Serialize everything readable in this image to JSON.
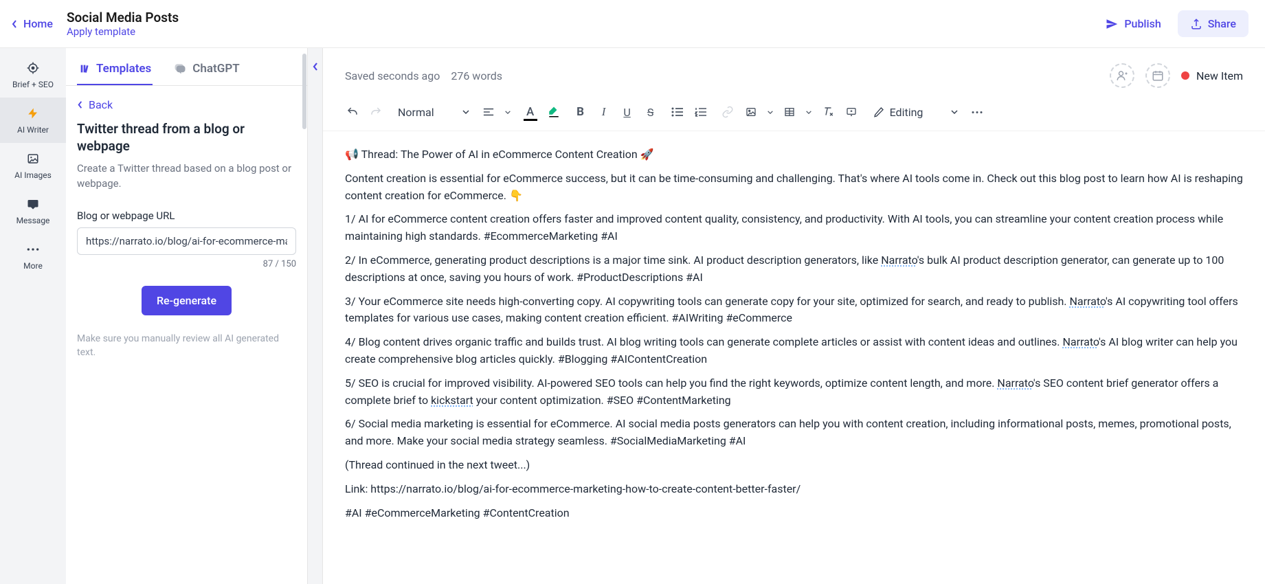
{
  "header": {
    "home": "Home",
    "title": "Social Media Posts",
    "apply_template": "Apply template",
    "publish": "Publish",
    "share": "Share"
  },
  "nav": {
    "brief_seo": "Brief + SEO",
    "ai_writer": "AI Writer",
    "ai_images": "AI Images",
    "message": "Message",
    "more": "More"
  },
  "panel": {
    "tab_templates": "Templates",
    "tab_chatgpt": "ChatGPT",
    "back": "Back",
    "template_title": "Twitter thread from a blog or webpage",
    "template_desc": "Create a Twitter thread based on a blog post or webpage.",
    "url_label": "Blog or webpage URL",
    "url_value": "https://narrato.io/blog/ai-for-ecommerce-ma",
    "char_count": "87 / 150",
    "regenerate": "Re-generate",
    "disclaimer": "Make sure you manually review all AI generated text."
  },
  "editor": {
    "saved": "Saved seconds ago",
    "word_count": "276 words",
    "status": "New Item",
    "style": "Normal",
    "mode": "Editing",
    "paragraphs": [
      "📢 Thread: The Power of AI in eCommerce Content Creation 🚀",
      "Content creation is essential for eCommerce success, but it can be time-consuming and challenging. That's where AI tools come in. Check out this blog post to learn how AI is reshaping content creation for eCommerce. 👇",
      "1/ AI for eCommerce content creation offers faster and improved content quality, consistency, and productivity. With AI tools, you can streamline your content creation process while maintaining high standards. #EcommerceMarketing #AI",
      "2/ In eCommerce, generating product descriptions is a major time sink. AI product description generators, like Narrato's bulk AI product description generator, can generate up to 100 descriptions at once, saving you hours of work. #ProductDescriptions #AI",
      "3/ Your eCommerce site needs high-converting copy. AI copywriting tools can generate copy for your site, optimized for search, and ready to publish. Narrato's AI copywriting tool offers templates for various use cases, making content creation efficient. #AIWriting #eCommerce",
      "4/ Blog content drives organic traffic and builds trust. AI blog writing tools can generate complete articles or assist with content ideas and outlines. Narrato's AI blog writer can help you create comprehensive blog articles quickly. #Blogging #AIContentCreation",
      "5/ SEO is crucial for improved visibility. AI-powered SEO tools can help you find the right keywords, optimize content length, and more. Narrato's SEO content brief generator offers a complete brief to kickstart your content optimization. #SEO #ContentMarketing",
      "6/ Social media marketing is essential for eCommerce. AI social media posts generators can help you with content creation, including informational posts, memes, promotional posts, and more. Make your social media strategy seamless. #SocialMediaMarketing #AI",
      "(Thread continued in the next tweet...)",
      "Link: https://narrato.io/blog/ai-for-ecommerce-marketing-how-to-create-content-better-faster/",
      "#AI #eCommerceMarketing #ContentCreation"
    ]
  }
}
